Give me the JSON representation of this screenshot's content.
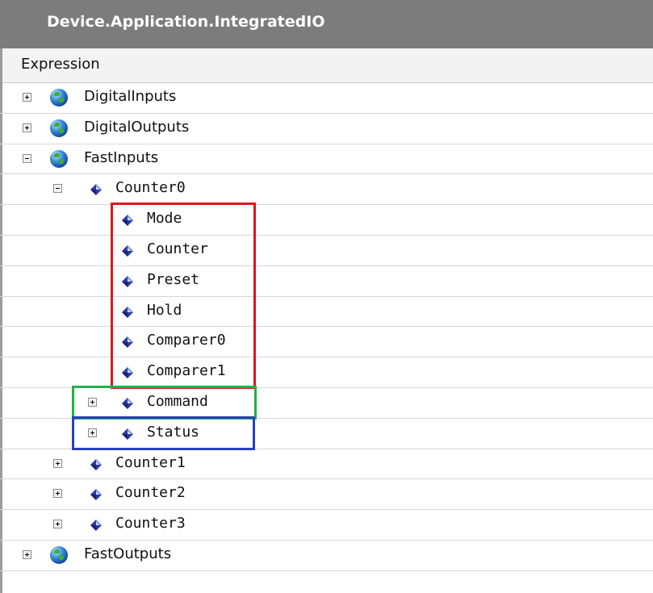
{
  "panel": {
    "title": "Device.Application.IntegratedIO",
    "column_header": "Expression"
  },
  "tree": [
    {
      "label": "DigitalInputs",
      "level": 0,
      "icon": "globe-icon",
      "toggle": "plus"
    },
    {
      "label": "DigitalOutputs",
      "level": 0,
      "icon": "globe-icon",
      "toggle": "plus"
    },
    {
      "label": "FastInputs",
      "level": 0,
      "icon": "globe-icon",
      "toggle": "minus"
    },
    {
      "label": "Counter0",
      "level": 1,
      "icon": "variable-icon",
      "toggle": "minus"
    },
    {
      "label": "Mode",
      "level": 2,
      "icon": "variable-icon",
      "toggle": "none"
    },
    {
      "label": "Counter",
      "level": 2,
      "icon": "variable-icon",
      "toggle": "none"
    },
    {
      "label": "Preset",
      "level": 2,
      "icon": "variable-icon",
      "toggle": "none"
    },
    {
      "label": "Hold",
      "level": 2,
      "icon": "variable-icon",
      "toggle": "none"
    },
    {
      "label": "Comparer0",
      "level": 2,
      "icon": "variable-icon",
      "toggle": "none"
    },
    {
      "label": "Comparer1",
      "level": 2,
      "icon": "variable-icon",
      "toggle": "none"
    },
    {
      "label": "Command",
      "level": 2,
      "icon": "variable-icon",
      "toggle": "plus"
    },
    {
      "label": "Status",
      "level": 2,
      "icon": "variable-icon",
      "toggle": "plus"
    },
    {
      "label": "Counter1",
      "level": 1,
      "icon": "variable-icon",
      "toggle": "plus"
    },
    {
      "label": "Counter2",
      "level": 1,
      "icon": "variable-icon",
      "toggle": "plus"
    },
    {
      "label": "Counter3",
      "level": 1,
      "icon": "variable-icon",
      "toggle": "plus"
    },
    {
      "label": "FastOutputs",
      "level": 0,
      "icon": "globe-icon",
      "toggle": "plus"
    }
  ],
  "highlights": {
    "red": "#e0151b",
    "green": "#22b04a",
    "blue": "#2a3fbf"
  }
}
